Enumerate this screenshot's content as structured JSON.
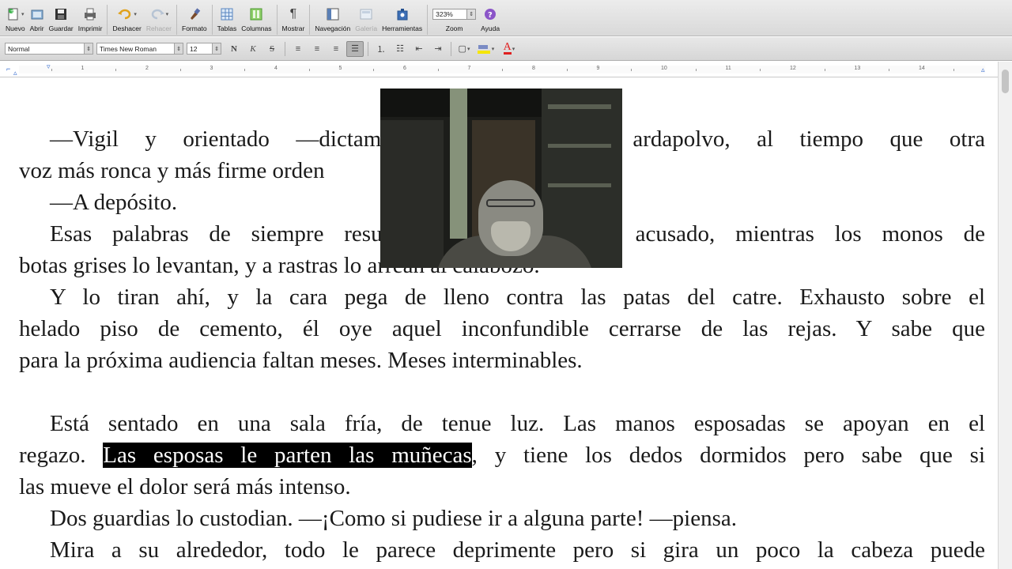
{
  "toolbar": {
    "buttons": [
      {
        "label": "Nuevo",
        "icon": "new-doc-icon"
      },
      {
        "label": "Abrir",
        "icon": "open-icon"
      },
      {
        "label": "Guardar",
        "icon": "save-icon"
      },
      {
        "label": "Imprimir",
        "icon": "print-icon"
      },
      {
        "label": "Deshacer",
        "icon": "undo-icon"
      },
      {
        "label": "Rehacer",
        "icon": "redo-icon"
      },
      {
        "label": "Formato",
        "icon": "format-brush-icon"
      },
      {
        "label": "Tablas",
        "icon": "table-icon"
      },
      {
        "label": "Columnas",
        "icon": "columns-icon"
      },
      {
        "label": "Mostrar",
        "icon": "pilcrow-icon"
      },
      {
        "label": "Navegación",
        "icon": "navigation-icon"
      },
      {
        "label": "Galería",
        "icon": "gallery-icon"
      },
      {
        "label": "Herramientas",
        "icon": "toolbox-icon"
      },
      {
        "label": "Zoom",
        "icon": "zoom-icon"
      },
      {
        "label": "Ayuda",
        "icon": "help-icon"
      }
    ],
    "zoom_value": "323%"
  },
  "formatbar": {
    "style": "Normal",
    "font": "Times New Roman",
    "size": "12",
    "bold_label": "N",
    "italic_label": "K",
    "strike_label": "S",
    "font_color_label": "A"
  },
  "ruler": {
    "numbers": [
      "1",
      "2",
      "3",
      "4",
      "5",
      "6",
      "7",
      "8",
      "9",
      "10",
      "11",
      "12",
      "13",
      "14"
    ]
  },
  "document": {
    "lines": [
      {
        "pre": "—Vigil y orientado —dictami",
        "post": "ardapolvo, al tiempo que otra"
      },
      {
        "text": "voz más ronca y más firme orden"
      },
      {
        "text": "—A depósito."
      },
      {
        "pre": "Esas palabras de siempre resu",
        "post": "acusado, mientras los monos de"
      },
      {
        "text": "botas grises lo levantan, y a rastras lo arrean al calabozo."
      },
      {
        "text": "Y lo tiran ahí, y la cara pega de lleno contra las patas del catre. Exhausto sobre el"
      },
      {
        "text": "helado piso de cemento, él oye aquel inconfundible cerrarse de las rejas. Y sabe que"
      },
      {
        "text": "para la próxima audiencia faltan meses. Meses interminables."
      },
      {
        "text": "Está sentado en una sala fría, de tenue luz. Las manos esposadas se apoyan en el"
      },
      {
        "pre": "regazo. ",
        "highlight": "Las esposas le parten las muñecas",
        "post": ", y tiene los dedos dormidos pero sabe que si"
      },
      {
        "text": "las mueve el dolor será más intenso."
      },
      {
        "text": "Dos guardias lo custodian. —¡Como si pudiese ir a alguna parte! —piensa."
      },
      {
        "text": "Mira a su alrededor, todo le parece deprimente pero si gira un poco la cabeza puede"
      }
    ]
  }
}
